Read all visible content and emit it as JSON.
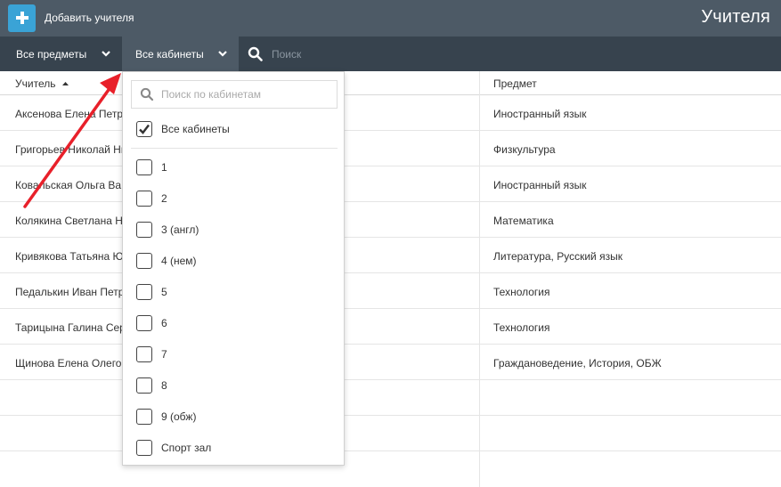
{
  "header": {
    "add_button_label": "Добавить учителя",
    "page_title": "Учителя"
  },
  "filters": {
    "subjects_label": "Все предметы",
    "rooms_label": "Все кабинеты",
    "search_placeholder": "Поиск"
  },
  "table": {
    "columns": [
      "Учитель",
      "Предмет"
    ],
    "rows": [
      {
        "teacher": "Аксенова Елена Петро",
        "subject": "Иностранный язык"
      },
      {
        "teacher": "Григорьев Николай Ни",
        "subject": "Физкультура"
      },
      {
        "teacher": "Ковальская Ольга Ва",
        "subject": "Иностранный язык"
      },
      {
        "teacher": "Колякина Светлана Н",
        "subject": "Математика"
      },
      {
        "teacher": "Кривякова Татьяна Ю",
        "subject": "Литература, Русский язык"
      },
      {
        "teacher": "Педалькин Иван Петр",
        "subject": "Технология"
      },
      {
        "teacher": "Тарицына Галина Сер",
        "subject": "Технология"
      },
      {
        "teacher": "Щинова Елена Олего",
        "subject": "Граждановедение, История, ОБЖ"
      }
    ]
  },
  "room_dropdown": {
    "search_placeholder": "Поиск по кабинетам",
    "all_label": "Все кабинеты",
    "all_checked": true,
    "items": [
      {
        "label": "1",
        "checked": false
      },
      {
        "label": "2",
        "checked": false
      },
      {
        "label": "3 (англ)",
        "checked": false
      },
      {
        "label": "4 (нем)",
        "checked": false
      },
      {
        "label": "5",
        "checked": false
      },
      {
        "label": "6",
        "checked": false
      },
      {
        "label": "7",
        "checked": false
      },
      {
        "label": "8",
        "checked": false
      },
      {
        "label": "9 (обж)",
        "checked": false
      },
      {
        "label": "Спорт зал",
        "checked": false
      }
    ]
  },
  "colors": {
    "topbar": "#4d5a66",
    "filterbar": "#37434e",
    "accent": "#3aa3d6",
    "annotation_arrow": "#e8202a"
  },
  "icons": [
    "plus-icon",
    "chevron-down-icon",
    "search-icon",
    "sort-asc-icon",
    "checkmark-icon"
  ]
}
